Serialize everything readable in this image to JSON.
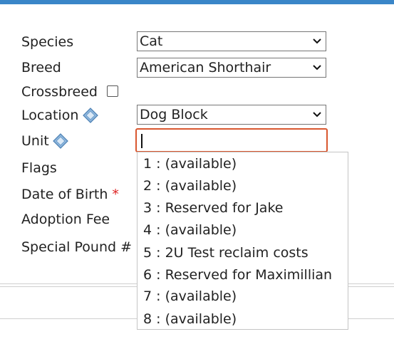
{
  "form": {
    "species": {
      "label": "Species",
      "value": "Cat"
    },
    "breed": {
      "label": "Breed",
      "value": "American Shorthair"
    },
    "crossbreed": {
      "label": "Crossbreed",
      "checked": false
    },
    "location": {
      "label": "Location",
      "value": "Dog Block"
    },
    "unit": {
      "label": "Unit",
      "value": ""
    },
    "flags": {
      "label": "Flags"
    },
    "date_of_birth": {
      "label": "Date of Birth",
      "required_mark": "*"
    },
    "adoption_fee": {
      "label": "Adoption Fee"
    },
    "special_pound": {
      "label": "Special Pound #"
    }
  },
  "unit_autocomplete": {
    "items": [
      "1 : (available)",
      "2 : (available)",
      "3 : Reserved for Jake",
      "4 : (available)",
      "5 : 2U Test reclaim costs",
      "6 : Reserved for Maximillian",
      "7 : (available)",
      "8 : (available)"
    ]
  },
  "colors": {
    "top_bar": "#3a86c8",
    "focus_border": "#d9572f",
    "required": "#dd2222"
  },
  "icons": {
    "info": "info-diamond-icon",
    "dropdown": "chevron-down-icon"
  }
}
